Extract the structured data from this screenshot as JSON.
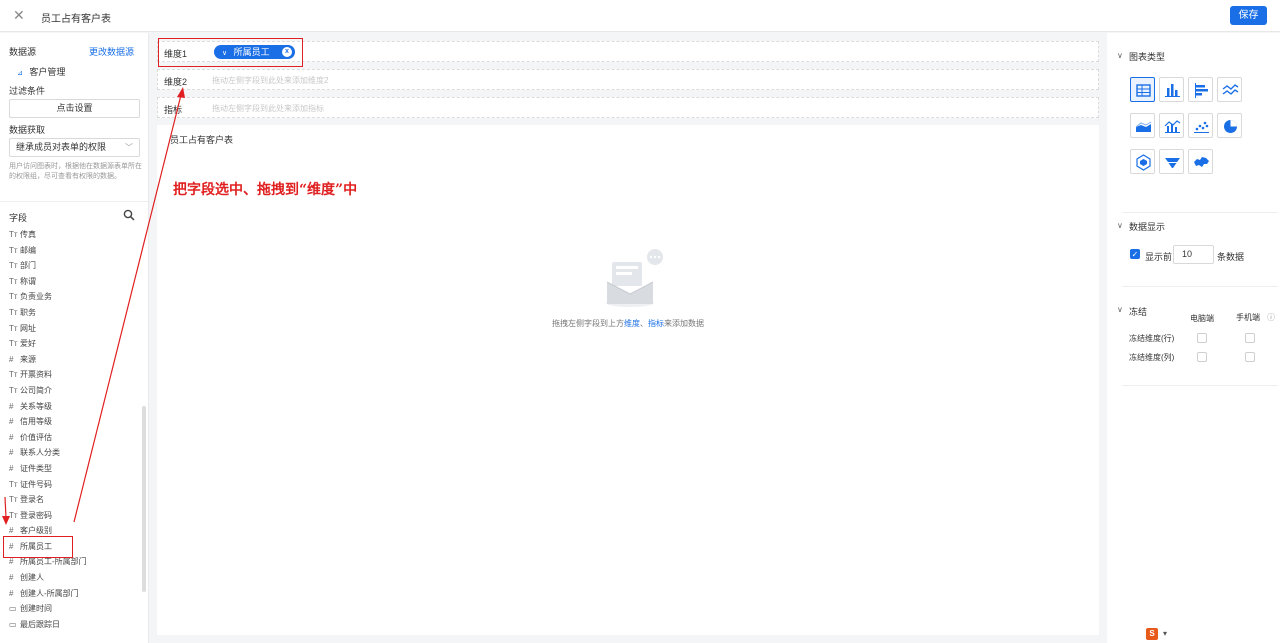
{
  "header": {
    "title": "员工占有客户表",
    "save_label": "保存"
  },
  "left": {
    "datasource_label": "数据源",
    "change_link": "更改数据源",
    "datasource_name": "客户管理",
    "filter_label": "过滤条件",
    "filter_button": "点击设置",
    "fetch_label": "数据获取",
    "fetch_select": "继承成员对表单的权限",
    "note": "用户访问图表时，根据他在数据源表单所在的权限组，尽可查看有权限的数据。",
    "fields_label": "字段",
    "fields": [
      {
        "icon": "Tт",
        "label": "传真"
      },
      {
        "icon": "Tт",
        "label": "邮编"
      },
      {
        "icon": "Tт",
        "label": "部门"
      },
      {
        "icon": "Tт",
        "label": "称谓"
      },
      {
        "icon": "Tт",
        "label": "负责业务"
      },
      {
        "icon": "Tт",
        "label": "职务"
      },
      {
        "icon": "Tт",
        "label": "网址"
      },
      {
        "icon": "Tт",
        "label": "爱好"
      },
      {
        "icon": "#",
        "label": "来源"
      },
      {
        "icon": "Tт",
        "label": "开票资料"
      },
      {
        "icon": "Tт",
        "label": "公司简介"
      },
      {
        "icon": "#",
        "label": "关系等级"
      },
      {
        "icon": "#",
        "label": "信用等级"
      },
      {
        "icon": "#",
        "label": "价值评估"
      },
      {
        "icon": "#",
        "label": "联系人分类"
      },
      {
        "icon": "#",
        "label": "证件类型"
      },
      {
        "icon": "Tт",
        "label": "证件号码"
      },
      {
        "icon": "Tт",
        "label": "登录名"
      },
      {
        "icon": "Tт",
        "label": "登录密码"
      },
      {
        "icon": "#",
        "label": "客户级别"
      },
      {
        "icon": "#",
        "label": "所属员工"
      },
      {
        "icon": "#",
        "label": "所属员工-所属部门"
      },
      {
        "icon": "#",
        "label": "创建人"
      },
      {
        "icon": "#",
        "label": "创建人-所属部门"
      },
      {
        "icon": "▭",
        "label": "创建时间"
      },
      {
        "icon": "▭",
        "label": "最后跟踪日"
      }
    ]
  },
  "center": {
    "dim1_label": "维度1",
    "dim1_pill": "所属员工",
    "dim2_label": "维度2",
    "dim2_placeholder": "拖动左侧字段到此处来添加维度2",
    "metric_label": "指标",
    "metric_placeholder": "拖动左侧字段到此处来添加指标",
    "canvas_title": "员工占有客户表",
    "empty_pre": "拖拽左侧字段到上方",
    "empty_dim": "维度",
    "empty_sep": "、",
    "empty_metric": "指标",
    "empty_post": "来添加数据",
    "annotation": "把字段选中、拖拽到“维度”中"
  },
  "right": {
    "chart_type_title": "图表类型",
    "data_display_title": "数据显示",
    "show_top_label": "显示前",
    "show_top_value": "10",
    "show_top_unit": "条数据",
    "freeze_title": "冻结",
    "col_pc": "电脑端",
    "col_mobile": "手机端",
    "freeze_row": "冻结维度(行)",
    "freeze_col": "冻结维度(列)"
  },
  "colors": {
    "accent": "#1a6fe6",
    "annotation": "#e02020"
  }
}
